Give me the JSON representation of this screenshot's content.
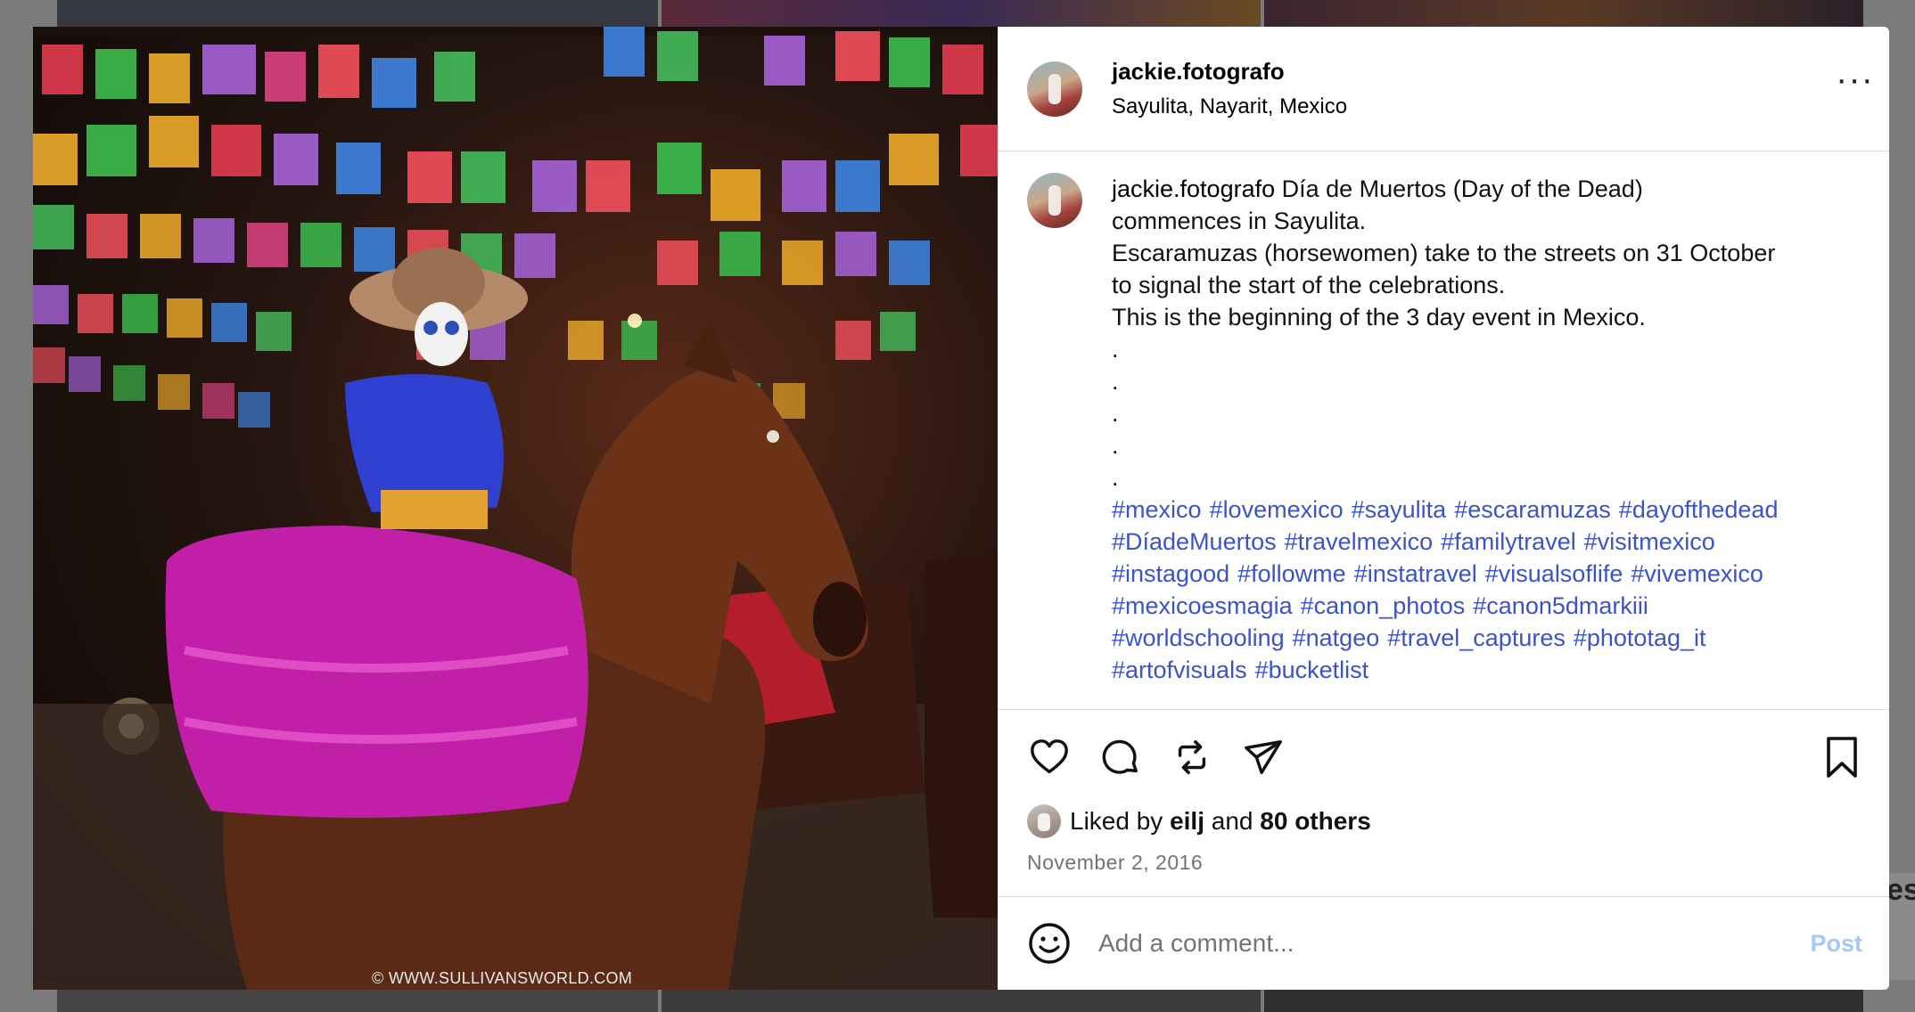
{
  "post": {
    "username": "jackie.fotografo",
    "location": "Sayulita, Nayarit, Mexico",
    "more_icon": "more-options-icon",
    "photo_watermark": "© WWW.SULLIVANSWORLD.COM",
    "caption": {
      "username": "jackie.fotografo",
      "lines": [
        "Día de Muertos (Day of the Dead)",
        "commences in Sayulita.",
        "Escaramuzas (horsewomen) take to the streets on 31 October",
        "to signal the start of the celebrations.",
        "This is the beginning of the 3 day event in Mexico.",
        ".",
        ".",
        ".",
        ".",
        "."
      ],
      "hashtags": [
        "#mexico",
        "#lovemexico",
        "#sayulita",
        "#escaramuzas",
        "#dayofthedead",
        "#DíadeMuertos",
        "#travelmexico",
        "#familytravel",
        "#visitmexico",
        "#instagood",
        "#followme",
        "#instatravel",
        "#visualsoflife",
        "#vivemexico",
        "#mexicoesmagia",
        "#canon_photos",
        "#canon5dmarkiii",
        "#worldschooling",
        "#natgeo",
        "#travel_captures",
        "#phototag_it",
        "#artofvisuals",
        "#bucketlist"
      ]
    },
    "actions": {
      "icons": [
        "heart-icon",
        "comment-icon",
        "repost-icon",
        "share-icon",
        "bookmark-icon"
      ]
    },
    "likes": {
      "prefix": "Liked by",
      "user": "eilj",
      "joiner": "and",
      "others": "80 others"
    },
    "date": "November 2, 2016",
    "comment": {
      "placeholder": "Add a comment...",
      "post_label": "Post"
    }
  },
  "colors": {
    "hashtag": "#3b53c9",
    "post_button_disabled": "#a9c7f5",
    "date": "#737373",
    "divider": "#dbdbdb"
  },
  "backdrop": {
    "partial_text": "es"
  }
}
